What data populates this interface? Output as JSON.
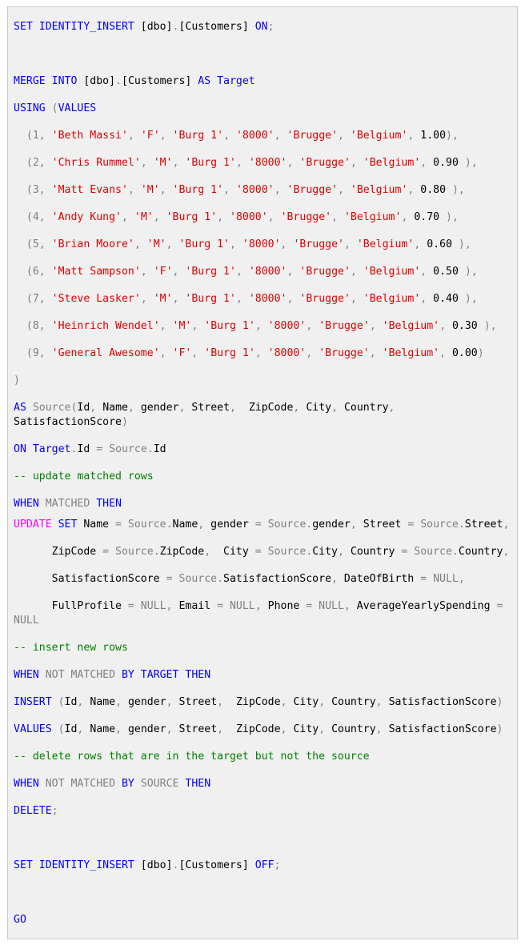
{
  "colors": {
    "background": "#f0f0f0",
    "border": "#c8c8c8",
    "keyword": "#0000ff",
    "string": "#dd0000",
    "operator": "#808080",
    "comment": "#008000",
    "function": "#ff00ff",
    "text": "#000000"
  },
  "code": {
    "lines": [
      [
        {
          "t": "k",
          "v": "SET IDENTITY_INSERT "
        },
        {
          "t": "n",
          "v": "[dbo]"
        },
        {
          "t": "g",
          "v": "."
        },
        {
          "t": "n",
          "v": "[Customers] "
        },
        {
          "t": "k",
          "v": "ON"
        },
        {
          "t": "g",
          "v": ";"
        }
      ],
      [
        {
          "t": "k",
          "v": "MERGE INTO "
        },
        {
          "t": "n",
          "v": "[dbo]"
        },
        {
          "t": "g",
          "v": "."
        },
        {
          "t": "n",
          "v": "[Customers] "
        },
        {
          "t": "k",
          "v": "AS Target"
        }
      ],
      [
        {
          "t": "k",
          "v": "USING "
        },
        {
          "t": "g",
          "v": "("
        },
        {
          "t": "k",
          "v": "VALUES"
        }
      ],
      [
        {
          "t": "g",
          "v": "  (1, "
        },
        {
          "t": "s",
          "v": "'Beth Massi'"
        },
        {
          "t": "g",
          "v": ", "
        },
        {
          "t": "s",
          "v": "'F'"
        },
        {
          "t": "g",
          "v": ", "
        },
        {
          "t": "s",
          "v": "'Burg 1'"
        },
        {
          "t": "g",
          "v": ", "
        },
        {
          "t": "s",
          "v": "'8000'"
        },
        {
          "t": "g",
          "v": ", "
        },
        {
          "t": "s",
          "v": "'Brugge'"
        },
        {
          "t": "g",
          "v": ", "
        },
        {
          "t": "s",
          "v": "'Belgium'"
        },
        {
          "t": "g",
          "v": ", "
        },
        {
          "t": "n",
          "v": "1.00"
        },
        {
          "t": "g",
          "v": "),"
        }
      ],
      [
        {
          "t": "g",
          "v": "  (2, "
        },
        {
          "t": "s",
          "v": "'Chris Rummel'"
        },
        {
          "t": "g",
          "v": ", "
        },
        {
          "t": "s",
          "v": "'M'"
        },
        {
          "t": "g",
          "v": ", "
        },
        {
          "t": "s",
          "v": "'Burg 1'"
        },
        {
          "t": "g",
          "v": ", "
        },
        {
          "t": "s",
          "v": "'8000'"
        },
        {
          "t": "g",
          "v": ", "
        },
        {
          "t": "s",
          "v": "'Brugge'"
        },
        {
          "t": "g",
          "v": ", "
        },
        {
          "t": "s",
          "v": "'Belgium'"
        },
        {
          "t": "g",
          "v": ", "
        },
        {
          "t": "n",
          "v": "0.90 "
        },
        {
          "t": "g",
          "v": "),"
        }
      ],
      [
        {
          "t": "g",
          "v": "  (3, "
        },
        {
          "t": "s",
          "v": "'Matt Evans'"
        },
        {
          "t": "g",
          "v": ", "
        },
        {
          "t": "s",
          "v": "'M'"
        },
        {
          "t": "g",
          "v": ", "
        },
        {
          "t": "s",
          "v": "'Burg 1'"
        },
        {
          "t": "g",
          "v": ", "
        },
        {
          "t": "s",
          "v": "'8000'"
        },
        {
          "t": "g",
          "v": ", "
        },
        {
          "t": "s",
          "v": "'Brugge'"
        },
        {
          "t": "g",
          "v": ", "
        },
        {
          "t": "s",
          "v": "'Belgium'"
        },
        {
          "t": "g",
          "v": ", "
        },
        {
          "t": "n",
          "v": "0.80 "
        },
        {
          "t": "g",
          "v": "),"
        }
      ],
      [
        {
          "t": "g",
          "v": "  (4, "
        },
        {
          "t": "s",
          "v": "'Andy Kung'"
        },
        {
          "t": "g",
          "v": ", "
        },
        {
          "t": "s",
          "v": "'M'"
        },
        {
          "t": "g",
          "v": ", "
        },
        {
          "t": "s",
          "v": "'Burg 1'"
        },
        {
          "t": "g",
          "v": ", "
        },
        {
          "t": "s",
          "v": "'8000'"
        },
        {
          "t": "g",
          "v": ", "
        },
        {
          "t": "s",
          "v": "'Brugge'"
        },
        {
          "t": "g",
          "v": ", "
        },
        {
          "t": "s",
          "v": "'Belgium'"
        },
        {
          "t": "g",
          "v": ", "
        },
        {
          "t": "n",
          "v": "0.70 "
        },
        {
          "t": "g",
          "v": "),"
        }
      ],
      [
        {
          "t": "g",
          "v": "  (5, "
        },
        {
          "t": "s",
          "v": "'Brian Moore'"
        },
        {
          "t": "g",
          "v": ", "
        },
        {
          "t": "s",
          "v": "'M'"
        },
        {
          "t": "g",
          "v": ", "
        },
        {
          "t": "s",
          "v": "'Burg 1'"
        },
        {
          "t": "g",
          "v": ", "
        },
        {
          "t": "s",
          "v": "'8000'"
        },
        {
          "t": "g",
          "v": ", "
        },
        {
          "t": "s",
          "v": "'Brugge'"
        },
        {
          "t": "g",
          "v": ", "
        },
        {
          "t": "s",
          "v": "'Belgium'"
        },
        {
          "t": "g",
          "v": ", "
        },
        {
          "t": "n",
          "v": "0.60 "
        },
        {
          "t": "g",
          "v": "),"
        }
      ],
      [
        {
          "t": "g",
          "v": "  (6, "
        },
        {
          "t": "s",
          "v": "'Matt Sampson'"
        },
        {
          "t": "g",
          "v": ", "
        },
        {
          "t": "s",
          "v": "'F'"
        },
        {
          "t": "g",
          "v": ", "
        },
        {
          "t": "s",
          "v": "'Burg 1'"
        },
        {
          "t": "g",
          "v": ", "
        },
        {
          "t": "s",
          "v": "'8000'"
        },
        {
          "t": "g",
          "v": ", "
        },
        {
          "t": "s",
          "v": "'Brugge'"
        },
        {
          "t": "g",
          "v": ", "
        },
        {
          "t": "s",
          "v": "'Belgium'"
        },
        {
          "t": "g",
          "v": ", "
        },
        {
          "t": "n",
          "v": "0.50 "
        },
        {
          "t": "g",
          "v": "),"
        }
      ],
      [
        {
          "t": "g",
          "v": "  (7, "
        },
        {
          "t": "s",
          "v": "'Steve Lasker'"
        },
        {
          "t": "g",
          "v": ", "
        },
        {
          "t": "s",
          "v": "'M'"
        },
        {
          "t": "g",
          "v": ", "
        },
        {
          "t": "s",
          "v": "'Burg 1'"
        },
        {
          "t": "g",
          "v": ", "
        },
        {
          "t": "s",
          "v": "'8000'"
        },
        {
          "t": "g",
          "v": ", "
        },
        {
          "t": "s",
          "v": "'Brugge'"
        },
        {
          "t": "g",
          "v": ", "
        },
        {
          "t": "s",
          "v": "'Belgium'"
        },
        {
          "t": "g",
          "v": ", "
        },
        {
          "t": "n",
          "v": "0.40 "
        },
        {
          "t": "g",
          "v": "),"
        }
      ],
      [
        {
          "t": "g",
          "v": "  (8, "
        },
        {
          "t": "s",
          "v": "'Heinrich Wendel'"
        },
        {
          "t": "g",
          "v": ", "
        },
        {
          "t": "s",
          "v": "'M'"
        },
        {
          "t": "g",
          "v": ", "
        },
        {
          "t": "s",
          "v": "'Burg 1'"
        },
        {
          "t": "g",
          "v": ", "
        },
        {
          "t": "s",
          "v": "'8000'"
        },
        {
          "t": "g",
          "v": ", "
        },
        {
          "t": "s",
          "v": "'Brugge'"
        },
        {
          "t": "g",
          "v": ", "
        },
        {
          "t": "s",
          "v": "'Belgium'"
        },
        {
          "t": "g",
          "v": ", "
        },
        {
          "t": "n",
          "v": "0.30 "
        },
        {
          "t": "g",
          "v": "),"
        }
      ],
      [
        {
          "t": "g",
          "v": "  (9, "
        },
        {
          "t": "s",
          "v": "'General Awesome'"
        },
        {
          "t": "g",
          "v": ", "
        },
        {
          "t": "s",
          "v": "'F'"
        },
        {
          "t": "g",
          "v": ", "
        },
        {
          "t": "s",
          "v": "'Burg 1'"
        },
        {
          "t": "g",
          "v": ", "
        },
        {
          "t": "s",
          "v": "'8000'"
        },
        {
          "t": "g",
          "v": ", "
        },
        {
          "t": "s",
          "v": "'Brugge'"
        },
        {
          "t": "g",
          "v": ", "
        },
        {
          "t": "s",
          "v": "'Belgium'"
        },
        {
          "t": "g",
          "v": ", "
        },
        {
          "t": "n",
          "v": "0.00"
        },
        {
          "t": "g",
          "v": ")"
        }
      ],
      [
        {
          "t": "g",
          "v": ")"
        }
      ],
      [
        {
          "t": "k",
          "v": "AS "
        },
        {
          "t": "g",
          "v": "Source("
        },
        {
          "t": "n",
          "v": "Id"
        },
        {
          "t": "g",
          "v": ", "
        },
        {
          "t": "n",
          "v": "Name"
        },
        {
          "t": "g",
          "v": ", "
        },
        {
          "t": "n",
          "v": "gender"
        },
        {
          "t": "g",
          "v": ", "
        },
        {
          "t": "n",
          "v": "Street"
        },
        {
          "t": "g",
          "v": ",  "
        },
        {
          "t": "n",
          "v": "ZipCode"
        },
        {
          "t": "g",
          "v": ", "
        },
        {
          "t": "n",
          "v": "City"
        },
        {
          "t": "g",
          "v": ", "
        },
        {
          "t": "n",
          "v": "Country"
        },
        {
          "t": "g",
          "v": ", "
        },
        {
          "t": "n",
          "v": "SatisfactionScore"
        },
        {
          "t": "g",
          "v": ")"
        }
      ],
      [
        {
          "t": "k",
          "v": "ON "
        },
        {
          "t": "k",
          "v": "Target"
        },
        {
          "t": "g",
          "v": "."
        },
        {
          "t": "n",
          "v": "Id "
        },
        {
          "t": "g",
          "v": "= Source."
        },
        {
          "t": "n",
          "v": "Id"
        }
      ],
      [
        {
          "t": "c",
          "v": "-- update matched rows"
        }
      ],
      [
        {
          "t": "k",
          "v": "WHEN "
        },
        {
          "t": "g",
          "v": "MATCHED "
        },
        {
          "t": "k",
          "v": "THEN"
        }
      ],
      [
        {
          "t": "m",
          "v": "UPDATE "
        },
        {
          "t": "k",
          "v": "SET "
        },
        {
          "t": "n",
          "v": "Name "
        },
        {
          "t": "g",
          "v": "= Source."
        },
        {
          "t": "n",
          "v": "Name"
        },
        {
          "t": "g",
          "v": ", "
        },
        {
          "t": "n",
          "v": "gender "
        },
        {
          "t": "g",
          "v": "= Source."
        },
        {
          "t": "n",
          "v": "gender"
        },
        {
          "t": "g",
          "v": ", "
        },
        {
          "t": "n",
          "v": "Street "
        },
        {
          "t": "g",
          "v": "= Source."
        },
        {
          "t": "n",
          "v": "Street"
        },
        {
          "t": "g",
          "v": ","
        }
      ],
      [
        {
          "t": "n",
          "v": "      ZipCode "
        },
        {
          "t": "g",
          "v": "= Source."
        },
        {
          "t": "n",
          "v": "ZipCode"
        },
        {
          "t": "g",
          "v": ",  "
        },
        {
          "t": "n",
          "v": "City "
        },
        {
          "t": "g",
          "v": "= Source."
        },
        {
          "t": "n",
          "v": "City"
        },
        {
          "t": "g",
          "v": ", "
        },
        {
          "t": "n",
          "v": "Country "
        },
        {
          "t": "g",
          "v": "= Source."
        },
        {
          "t": "n",
          "v": "Country"
        },
        {
          "t": "g",
          "v": ","
        }
      ],
      [
        {
          "t": "n",
          "v": "      SatisfactionScore "
        },
        {
          "t": "g",
          "v": "= Source."
        },
        {
          "t": "n",
          "v": "SatisfactionScore"
        },
        {
          "t": "g",
          "v": ", "
        },
        {
          "t": "n",
          "v": "DateOfBirth "
        },
        {
          "t": "g",
          "v": "= NULL,"
        }
      ],
      [
        {
          "t": "n",
          "v": "      FullProfile "
        },
        {
          "t": "g",
          "v": "= NULL, "
        },
        {
          "t": "n",
          "v": "Email "
        },
        {
          "t": "g",
          "v": "= NULL, "
        },
        {
          "t": "n",
          "v": "Phone "
        },
        {
          "t": "g",
          "v": "= NULL, "
        },
        {
          "t": "n",
          "v": "AverageYearlySpending "
        },
        {
          "t": "g",
          "v": "= NULL"
        }
      ],
      [
        {
          "t": "c",
          "v": "-- insert new rows"
        }
      ],
      [
        {
          "t": "k",
          "v": "WHEN "
        },
        {
          "t": "g",
          "v": "NOT MATCHED "
        },
        {
          "t": "k",
          "v": "BY TARGET THEN"
        }
      ],
      [
        {
          "t": "k",
          "v": "INSERT "
        },
        {
          "t": "g",
          "v": "("
        },
        {
          "t": "n",
          "v": "Id"
        },
        {
          "t": "g",
          "v": ", "
        },
        {
          "t": "n",
          "v": "Name"
        },
        {
          "t": "g",
          "v": ", "
        },
        {
          "t": "n",
          "v": "gender"
        },
        {
          "t": "g",
          "v": ", "
        },
        {
          "t": "n",
          "v": "Street"
        },
        {
          "t": "g",
          "v": ",  "
        },
        {
          "t": "n",
          "v": "ZipCode"
        },
        {
          "t": "g",
          "v": ", "
        },
        {
          "t": "n",
          "v": "City"
        },
        {
          "t": "g",
          "v": ", "
        },
        {
          "t": "n",
          "v": "Country"
        },
        {
          "t": "g",
          "v": ", "
        },
        {
          "t": "n",
          "v": "SatisfactionScore"
        },
        {
          "t": "g",
          "v": ")"
        }
      ],
      [
        {
          "t": "k",
          "v": "VALUES "
        },
        {
          "t": "g",
          "v": "("
        },
        {
          "t": "n",
          "v": "Id"
        },
        {
          "t": "g",
          "v": ", "
        },
        {
          "t": "n",
          "v": "Name"
        },
        {
          "t": "g",
          "v": ", "
        },
        {
          "t": "n",
          "v": "gender"
        },
        {
          "t": "g",
          "v": ", "
        },
        {
          "t": "n",
          "v": "Street"
        },
        {
          "t": "g",
          "v": ",  "
        },
        {
          "t": "n",
          "v": "ZipCode"
        },
        {
          "t": "g",
          "v": ", "
        },
        {
          "t": "n",
          "v": "City"
        },
        {
          "t": "g",
          "v": ", "
        },
        {
          "t": "n",
          "v": "Country"
        },
        {
          "t": "g",
          "v": ", "
        },
        {
          "t": "n",
          "v": "SatisfactionScore"
        },
        {
          "t": "g",
          "v": ")"
        }
      ],
      [
        {
          "t": "c",
          "v": "-- delete rows that are in the target but not the source"
        }
      ],
      [
        {
          "t": "k",
          "v": "WHEN "
        },
        {
          "t": "g",
          "v": "NOT MATCHED "
        },
        {
          "t": "k",
          "v": "BY "
        },
        {
          "t": "g",
          "v": "SOURCE "
        },
        {
          "t": "k",
          "v": "THEN"
        }
      ],
      [
        {
          "t": "k",
          "v": "DELETE"
        },
        {
          "t": "g",
          "v": ";"
        }
      ],
      [
        {
          "t": "k",
          "v": "SET IDENTITY_INSERT "
        },
        {
          "t": "n",
          "v": "[dbo]"
        },
        {
          "t": "g",
          "v": "."
        },
        {
          "t": "n",
          "v": "[Customers] "
        },
        {
          "t": "k",
          "v": "OFF"
        },
        {
          "t": "g",
          "v": ";"
        }
      ],
      [
        {
          "t": "k",
          "v": "GO"
        }
      ]
    ]
  }
}
